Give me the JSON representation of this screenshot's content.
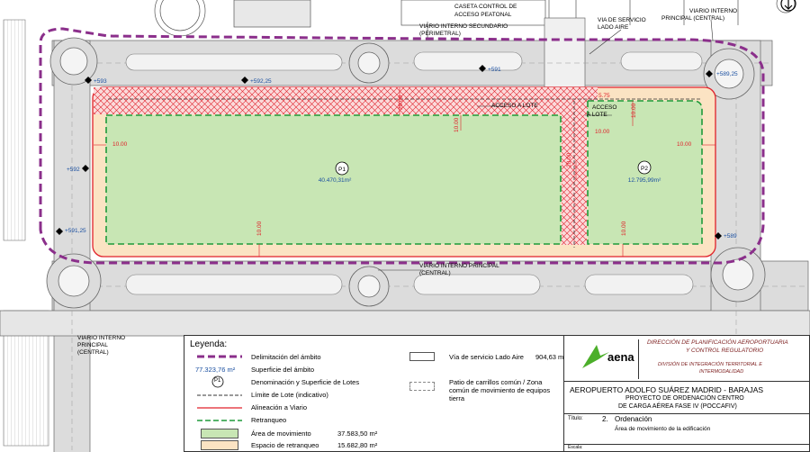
{
  "labels": {
    "caseta": [
      "CASETA CONTROL DE",
      "ACCESO PEATONAL"
    ],
    "viario_sec": [
      "VIARIO INTERNO SECUNDARIO",
      "(PERIMETRAL)"
    ],
    "via_servicio": [
      "VIA DE SERVICIO",
      "LADO AIRE"
    ],
    "viario_principal_top": [
      "VIARIO INTERNO",
      "PRINCIPAL (CENTRAL)"
    ],
    "viario_principal_mid": [
      "VIARIO INTERNO PRINCIPAL",
      "(CENTRAL)"
    ],
    "viario_principal_left": [
      "VIARIO INTERNO",
      "PRINCIPAL",
      "(CENTRAL)"
    ],
    "acceso_lote_1": "ACCESO A LOTE",
    "acceso_lote_2": [
      "ACCESO",
      "A LOTE"
    ]
  },
  "elevations": [
    "+593",
    "+592,25",
    "+591",
    "+589,25",
    "+592",
    "+591,25",
    "+589"
  ],
  "dimensions": {
    "d10": "10.00",
    "d20": "20.00",
    "d575": "5.75"
  },
  "plots": [
    {
      "id": "P1",
      "area": "40.470,31m²"
    },
    {
      "id": "P2",
      "area": "12.795,99m²"
    }
  ],
  "legend": {
    "title": "Leyenda:",
    "items": [
      {
        "label": "Delimitación del ámbito"
      },
      {
        "value": "77.323,76 m²",
        "label": "Superficie del ámbito"
      },
      {
        "symbol": "P1",
        "label": "Denominación y Superficie de Lotes"
      },
      {
        "label": "Límite de Lote (indicativo)"
      },
      {
        "label": "Alineación a Viario"
      },
      {
        "label": "Retranqueo"
      },
      {
        "label": "Área de movimiento",
        "value": "37.583,50 m²"
      },
      {
        "label": "Espacio de retranqueo",
        "value": "15.682,80 m²"
      }
    ],
    "items_right": [
      {
        "label": "Vía de servicio Lado Aire",
        "value": "904,63 m²"
      },
      {
        "label": "Patio de carrillos común / Zona común de movimiento de equipos tierra"
      }
    ]
  },
  "colors": {
    "green_fill": "#c8e6b4",
    "setback_fill": "#fbe3c3",
    "purple": "#8b2f8b",
    "red": "#e0202a",
    "green_dash": "#1e9a3a",
    "aena_green": "#4caf2a"
  },
  "titleblock": {
    "direccion": [
      "DIRECCIÓN DE PLANIFICACIÓN AEROPORTUARIA",
      "Y CONTROL REGULATORIO"
    ],
    "division": [
      "DIVISIÓN DE INTEGRACIÓN TERRITORIAL E",
      "INTERMODALIDAD"
    ],
    "logo": "aena",
    "airport": "AEROPUERTO ADOLFO SUÁREZ MADRID - BARAJAS",
    "project": [
      "PROYECTO DE ORDENACIÓN CENTRO",
      "DE CARGA AÉREA FASE IV (POCCAFIV)"
    ],
    "titulo_label": "Título:",
    "titulo_num": "2.",
    "titulo": "Ordenación",
    "subtitulo": "Área de movimiento de la edificación",
    "escala_label": "Escala:"
  }
}
